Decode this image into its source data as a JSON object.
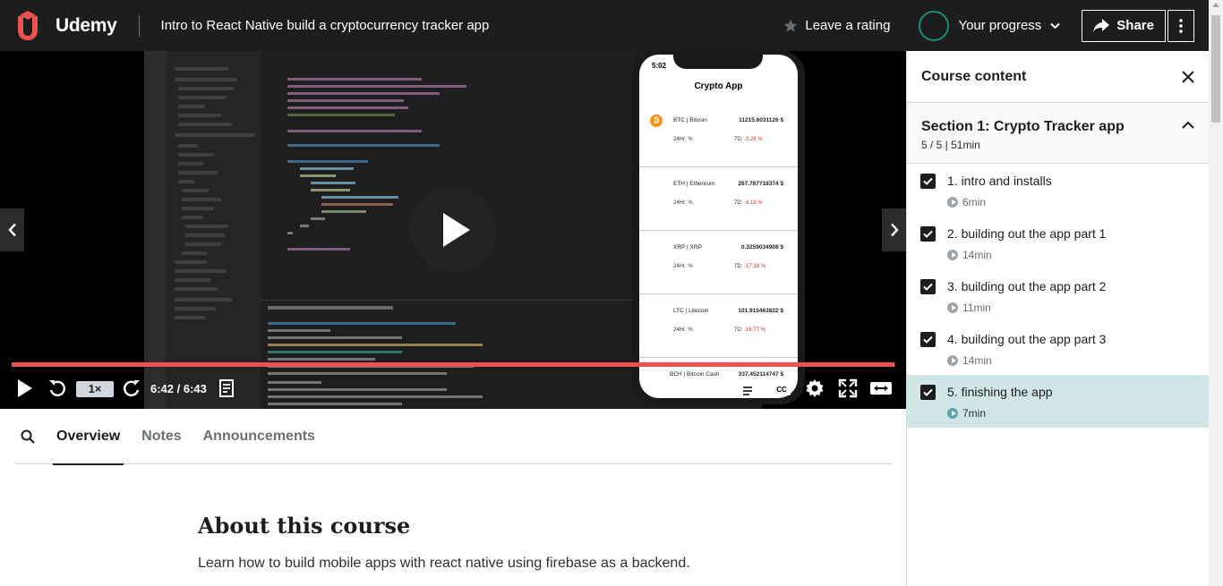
{
  "header": {
    "brand": "Udemy",
    "course_title": "Intro to React Native build a cryptocurrency tracker app",
    "rating_label": "Leave a rating",
    "progress_label": "Your progress",
    "share_label": "Share"
  },
  "video": {
    "speed": "1×",
    "time": "6:42 / 6:43",
    "progress_fraction": 0.998,
    "phone": {
      "clock": "5:02",
      "app_title": "Crypto App",
      "coins": [
        {
          "name": "BTC | Bitcoin",
          "price": "11215.6031126 $",
          "change_24h": "24Hr: %",
          "change_7d_label": "7D:",
          "change_7d": "-3.26 %"
        },
        {
          "name": "ETH | Ethereum",
          "price": "267.787718374 $",
          "change_24h": "24Hr: %",
          "change_7d_label": "7D:",
          "change_7d": "-8.18 %"
        },
        {
          "name": "XRP | XRP",
          "price": "0.3259034908 $",
          "change_24h": "24Hr: %",
          "change_7d_label": "7D:",
          "change_7d": "-17.18 %"
        },
        {
          "name": "LTC | Litecoin",
          "price": "101.915463822 $",
          "change_24h": "24Hr: %",
          "change_7d_label": "7D:",
          "change_7d": "-16.77 %"
        },
        {
          "name": "BCH | Bitcoin Cash",
          "price": "337.452114747 $"
        }
      ]
    }
  },
  "tabs": {
    "items": [
      "Overview",
      "Notes",
      "Announcements"
    ],
    "active": "Overview"
  },
  "about": {
    "title": "About this course",
    "description": "Learn how to build mobile apps with react native using firebase as a backend."
  },
  "sidebar": {
    "title": "Course content",
    "section": {
      "title": "Section 1: Crypto Tracker app",
      "meta": "5 / 5 | 51min"
    },
    "lectures": [
      {
        "title": "1. intro and installs",
        "duration": "6min",
        "completed": true
      },
      {
        "title": "2. building out the app part 1",
        "duration": "14min",
        "completed": true
      },
      {
        "title": "3. building out the app part 2",
        "duration": "11min",
        "completed": true
      },
      {
        "title": "4. building out the app part 3",
        "duration": "14min",
        "completed": true
      },
      {
        "title": "5. finishing the app",
        "duration": "7min",
        "completed": true,
        "current": true
      }
    ]
  },
  "colors": {
    "header_bg": "#1c1d1f",
    "accent_red": "#ec5252",
    "progress_ring": "#1e8d6e",
    "current_lecture_bg": "#d1e4e6"
  }
}
